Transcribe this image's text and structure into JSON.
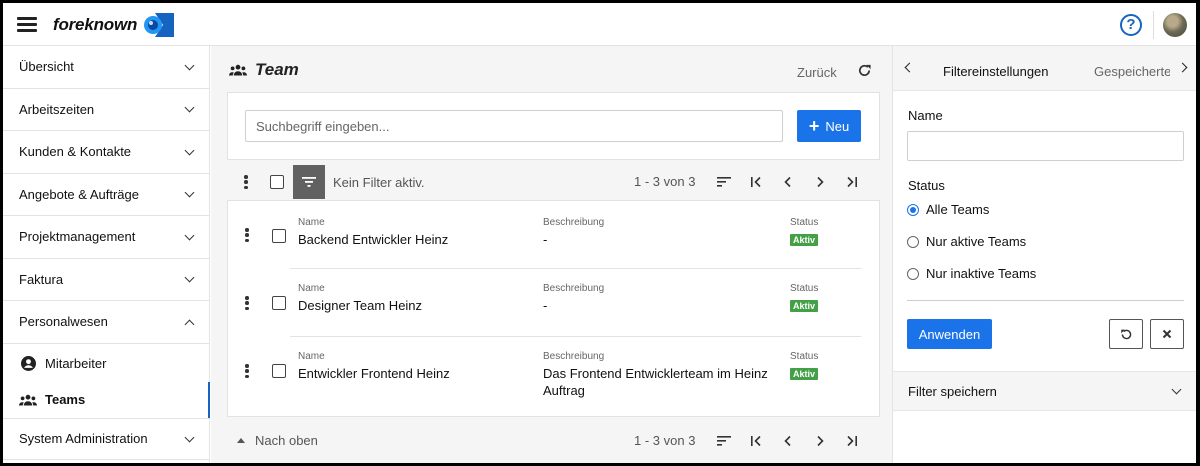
{
  "app": {
    "brand": "foreknown",
    "help_label": "?"
  },
  "sidebar": {
    "items": [
      {
        "label": "Übersicht",
        "expanded": false
      },
      {
        "label": "Arbeitszeiten",
        "expanded": false
      },
      {
        "label": "Kunden & Kontakte",
        "expanded": false
      },
      {
        "label": "Angebote & Aufträge",
        "expanded": false
      },
      {
        "label": "Projektmanagement",
        "expanded": false
      },
      {
        "label": "Faktura",
        "expanded": false
      },
      {
        "label": "Personalwesen",
        "expanded": true
      },
      {
        "label": "System Administration",
        "expanded": false
      }
    ],
    "subitems": [
      {
        "label": "Mitarbeiter",
        "icon": "person-icon",
        "active": false
      },
      {
        "label": "Teams",
        "icon": "team-icon",
        "active": true
      }
    ]
  },
  "main": {
    "title": "Team",
    "back_label": "Zurück",
    "search": {
      "placeholder": "Suchbegriff eingeben...",
      "value": ""
    },
    "new_label": "Neu",
    "filter_text": "Kein Filter aktiv.",
    "pagination": "1 - 3 von 3",
    "to_top_label": "Nach oben",
    "columns": {
      "name": "Name",
      "description": "Beschreibung",
      "status": "Status"
    },
    "rows": [
      {
        "name": "Backend Entwickler Heinz",
        "description": "-",
        "status": "Aktiv"
      },
      {
        "name": "Designer Team Heinz",
        "description": "-",
        "status": "Aktiv"
      },
      {
        "name": "Entwickler Frontend Heinz",
        "description": "Das Frontend Entwicklerteam im Heinz Auftrag",
        "status": "Aktiv"
      }
    ]
  },
  "panel": {
    "tabs": [
      {
        "label": "Filtereinstellungen",
        "active": true
      },
      {
        "label": "Gespeicherte",
        "active": false
      }
    ],
    "name_label": "Name",
    "name_value": "",
    "status_label": "Status",
    "status_options": [
      {
        "label": "Alle Teams",
        "selected": true
      },
      {
        "label": "Nur aktive Teams",
        "selected": false
      },
      {
        "label": "Nur inaktive Teams",
        "selected": false
      }
    ],
    "apply_label": "Anwenden",
    "save_filter_label": "Filter speichern"
  },
  "colors": {
    "accent": "#1a73e8",
    "active_badge": "#43a047",
    "filter_button": "#616161"
  }
}
